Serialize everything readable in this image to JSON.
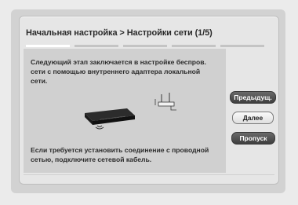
{
  "dialog": {
    "title": "Начальная настройка > Настройки сети (1/5)",
    "steps_total": 5,
    "current_step": 1,
    "text_top": "Следующий этап заключается в настройке беспров. сети с помощью внутреннего адаптера локальной сети.",
    "text_bottom": "Если требуется установить соединение с проводной сетью, подключите сетевой кабель."
  },
  "buttons": {
    "prev_label": "Предыдущ.",
    "next_label": "Далее",
    "skip_label": "Пропуск"
  },
  "illustration": {
    "device_icon": "blu-ray-player-icon",
    "router_icon": "wireless-router-icon",
    "signal_icon": "wifi-signal-icon"
  },
  "colors": {
    "selected_button": "#4a4a4a",
    "progress_active": "#ffffff"
  }
}
